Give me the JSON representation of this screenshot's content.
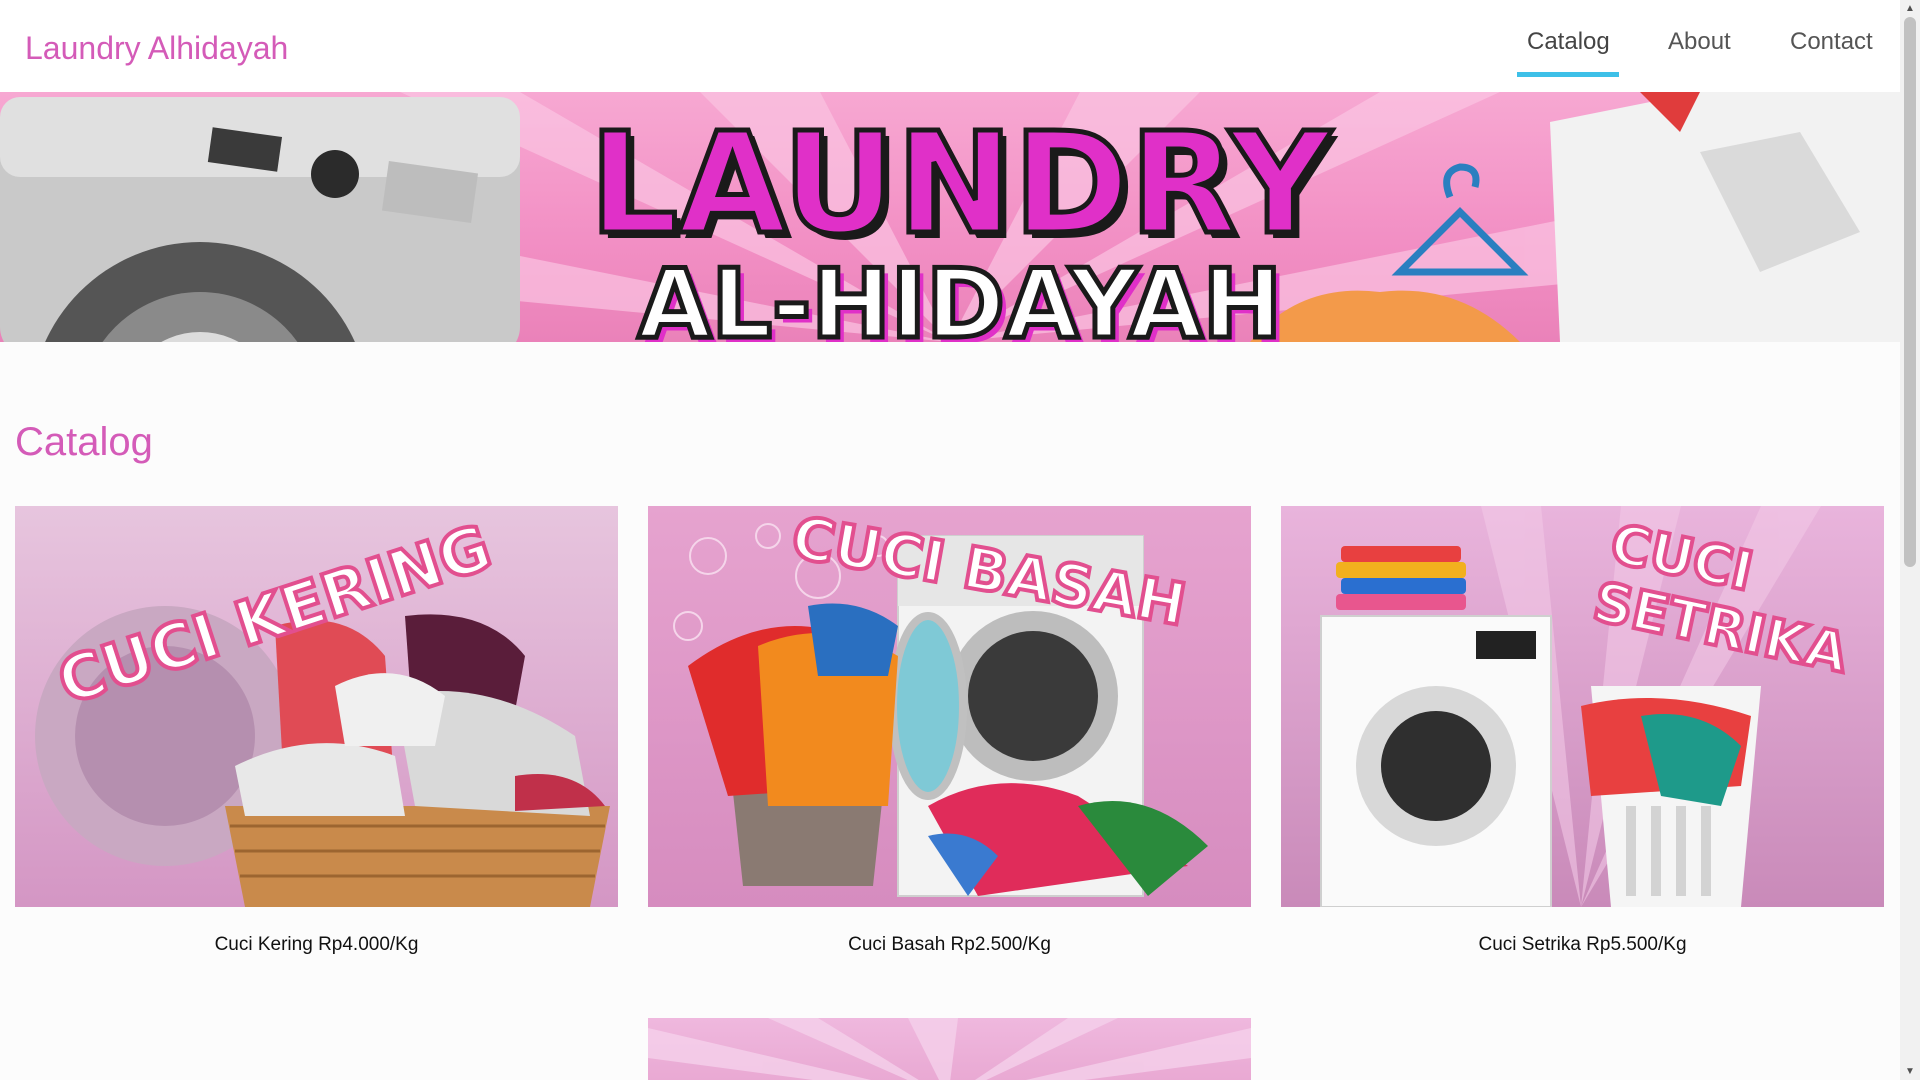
{
  "navbar": {
    "brand": "Laundry Alhidayah",
    "links": [
      {
        "label": "Catalog",
        "active": true
      },
      {
        "label": "About",
        "active": false
      },
      {
        "label": "Contact",
        "active": false
      }
    ],
    "accent_color": "#3dc0e8"
  },
  "hero": {
    "line1": "LAUNDRY",
    "line2": "AL-HIDAYAH"
  },
  "catalog": {
    "title": "Catalog",
    "items": [
      {
        "image_text": "CUCI KERING",
        "caption": "Cuci Kering Rp4.000/Kg"
      },
      {
        "image_text": "CUCI BASAH",
        "caption": "Cuci Basah Rp2.500/Kg"
      },
      {
        "image_text_line1": "CUCI",
        "image_text_line2": "SETRIKA",
        "caption": "Cuci Setrika Rp5.500/Kg"
      }
    ]
  },
  "colors": {
    "brand_pink": "#d45bb8",
    "hero_pink": "#f28fc4",
    "title_magenta": "#e030c8"
  },
  "scrollbar": {
    "up_icon": "▲",
    "down_icon": "▼"
  }
}
